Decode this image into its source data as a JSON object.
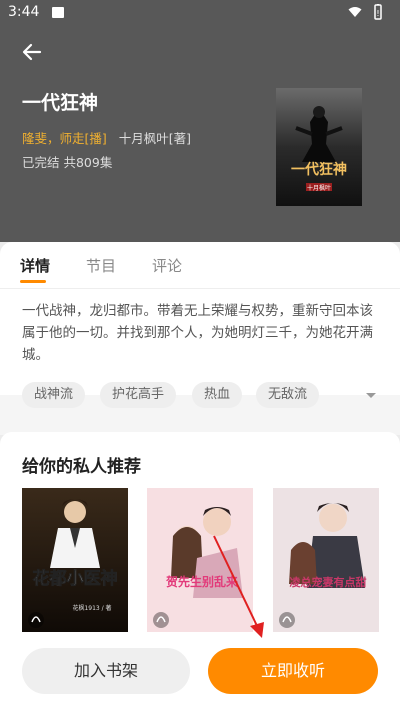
{
  "status_bar": {
    "time": "3:44"
  },
  "book": {
    "title": "一代狂神",
    "narrators": "隆斐，师走[播]",
    "author": "十月枫叶[著]",
    "meta": "已完结  共809集",
    "cover": {
      "title_text": "一代狂神",
      "author_text": "十月枫叶"
    }
  },
  "tabs": [
    {
      "label": "详情",
      "active": true
    },
    {
      "label": "节目",
      "active": false
    },
    {
      "label": "评论",
      "active": false
    }
  ],
  "description": "一代战神，龙归都市。带着无上荣耀与权势，重新守回本该属于他的一切。并找到那个人，为她明灯三千，为她花开满城。",
  "tags": [
    "战神流",
    "护花高手",
    "热血",
    "无敌流"
  ],
  "recommend": {
    "title": "给你的私人推荐",
    "books": [
      {
        "cover_title": "花都小医神",
        "cover_author": "花枫1913 / 著"
      },
      {
        "cover_title": "贺先生别乱来",
        "cover_author": ""
      },
      {
        "cover_title": "凌总宠妻有点甜",
        "cover_author": ""
      }
    ]
  },
  "actions": {
    "add_shelf": "加入书架",
    "listen_now": "立即收听"
  },
  "colors": {
    "accent": "#ff8a00",
    "narrator": "#f0b030",
    "header_bg": "#585858"
  }
}
